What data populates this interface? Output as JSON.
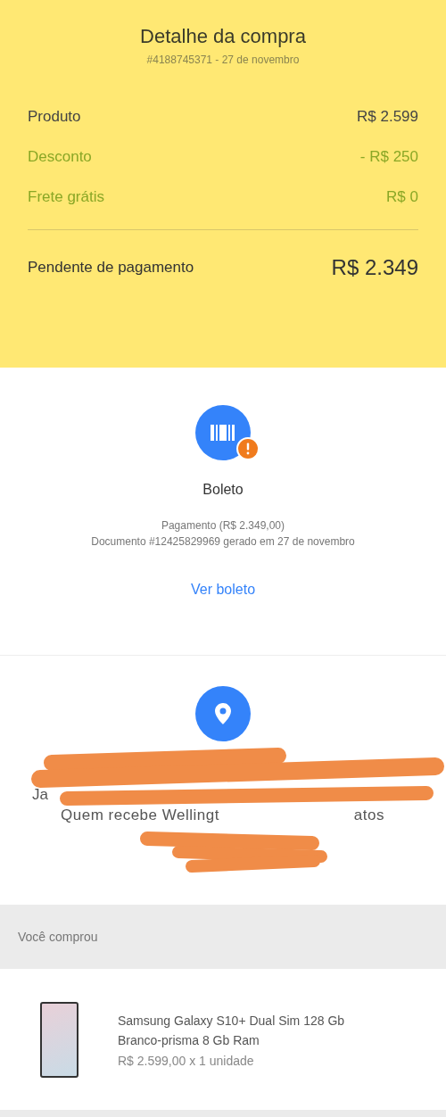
{
  "header": {
    "title": "Detalhe da compra",
    "order": "#4188745371 - 27 de novembro"
  },
  "summary": {
    "rows": [
      {
        "label": "Produto",
        "amount": "R$ 2.599",
        "kind": "charge"
      },
      {
        "label": "Desconto",
        "amount": "- R$ 250",
        "kind": "benefit"
      },
      {
        "label": "Frete grátis",
        "amount": "R$ 0",
        "kind": "benefit"
      }
    ],
    "total": {
      "label": "Pendente de pagamento",
      "amount": "R$ 2.349"
    }
  },
  "payment": {
    "method": "Boleto",
    "details": [
      "Pagamento (R$ 2.349,00)",
      "Documento #12425829969 gerado em 27 de novembro"
    ],
    "link": "Ver boleto"
  },
  "shipping": {
    "address_fragment": "Ja",
    "recipient_fragments": [
      "Quem recebe Wellingt",
      "atos"
    ]
  },
  "purchased": {
    "heading": "Você comprou",
    "items": [
      {
        "name": "Samsung Galaxy S10+ Dual Sim 128 Gb Branco-prisma 8 Gb Ram",
        "price": "R$ 2.599,00 x 1 unidade"
      }
    ]
  }
}
